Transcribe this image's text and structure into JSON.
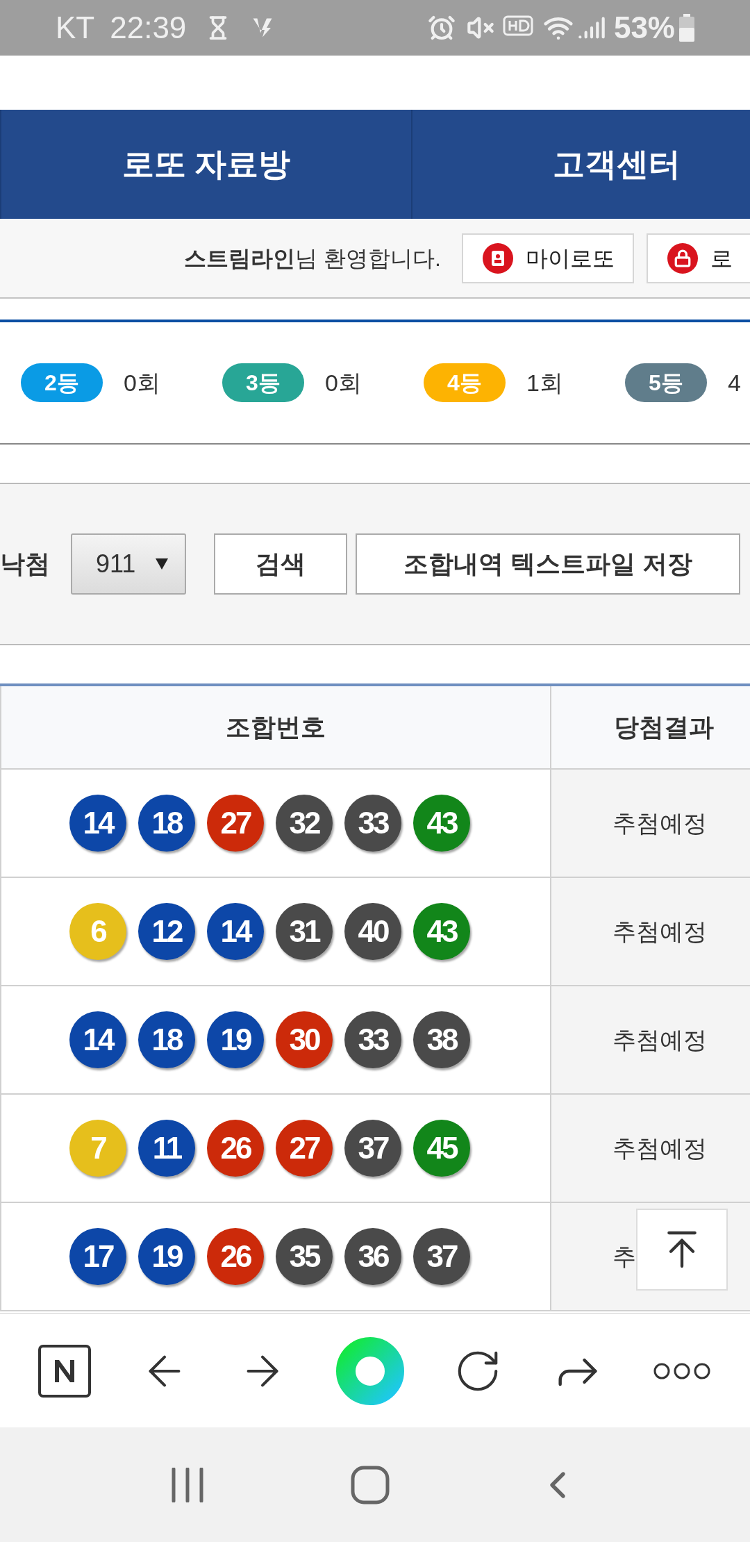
{
  "status_bar": {
    "carrier": "KT",
    "time": "22:39",
    "battery": "53%"
  },
  "nav_tabs": [
    {
      "label": "로또 자료방"
    },
    {
      "label": "고객센터"
    }
  ],
  "welcome": {
    "text": "**스트림라인**님 환영합니다.",
    "buttons": [
      {
        "label": "마이로또",
        "kind": "mylotto"
      },
      {
        "label": "로",
        "kind": "lock"
      }
    ]
  },
  "rank_counts": [
    {
      "rank": "2등",
      "count": "0회",
      "color": "#0a9be5"
    },
    {
      "rank": "3등",
      "count": "0회",
      "color": "#28a696"
    },
    {
      "rank": "4등",
      "count": "1회",
      "color": "#fdb302"
    },
    {
      "rank": "5등",
      "count": "4",
      "color": "#607d8b"
    }
  ],
  "search": {
    "label": "낙첨",
    "round": "911",
    "buttons": [
      "검색",
      "조합내역 텍스트파일 저장"
    ]
  },
  "table": {
    "columns": [
      "조합번호",
      "당첨결과"
    ],
    "rows": [
      {
        "balls": [
          {
            "number": "14",
            "color": "#0d47a8"
          },
          {
            "number": "18",
            "color": "#0d47a8"
          },
          {
            "number": "27",
            "color": "#cc2a0a"
          },
          {
            "number": "32",
            "color": "#4a4a4a"
          },
          {
            "number": "33",
            "color": "#4a4a4a"
          },
          {
            "number": "43",
            "color": "#12861a"
          }
        ],
        "result": "추첨예정"
      },
      {
        "balls": [
          {
            "number": "6",
            "color": "#e6bf1c"
          },
          {
            "number": "12",
            "color": "#0d47a8"
          },
          {
            "number": "14",
            "color": "#0d47a8"
          },
          {
            "number": "31",
            "color": "#4a4a4a"
          },
          {
            "number": "40",
            "color": "#4a4a4a"
          },
          {
            "number": "43",
            "color": "#12861a"
          }
        ],
        "result": "추첨예정"
      },
      {
        "balls": [
          {
            "number": "14",
            "color": "#0d47a8"
          },
          {
            "number": "18",
            "color": "#0d47a8"
          },
          {
            "number": "19",
            "color": "#0d47a8"
          },
          {
            "number": "30",
            "color": "#cc2a0a"
          },
          {
            "number": "33",
            "color": "#4a4a4a"
          },
          {
            "number": "38",
            "color": "#4a4a4a"
          }
        ],
        "result": "추첨예정"
      },
      {
        "balls": [
          {
            "number": "7",
            "color": "#e6bf1c"
          },
          {
            "number": "11",
            "color": "#0d47a8"
          },
          {
            "number": "26",
            "color": "#cc2a0a"
          },
          {
            "number": "27",
            "color": "#cc2a0a"
          },
          {
            "number": "37",
            "color": "#4a4a4a"
          },
          {
            "number": "45",
            "color": "#12861a"
          }
        ],
        "result": "추첨예정"
      },
      {
        "balls": [
          {
            "number": "17",
            "color": "#0d47a8"
          },
          {
            "number": "19",
            "color": "#0d47a8"
          },
          {
            "number": "26",
            "color": "#cc2a0a"
          },
          {
            "number": "35",
            "color": "#4a4a4a"
          },
          {
            "number": "36",
            "color": "#4a4a4a"
          },
          {
            "number": "37",
            "color": "#4a4a4a"
          }
        ],
        "result": "추"
      }
    ]
  }
}
